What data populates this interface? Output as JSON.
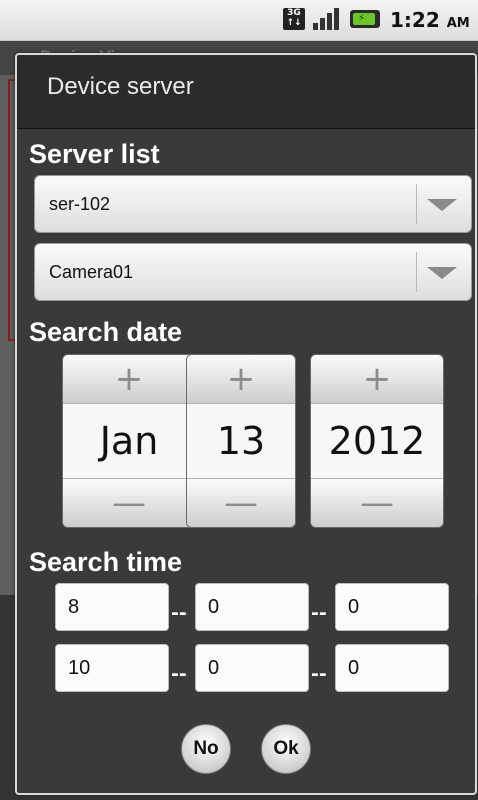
{
  "status_bar": {
    "network_type": "3G",
    "time": "1:22",
    "ampm": "AM",
    "icons": [
      "3g-icon",
      "signal-icon",
      "battery-charging-icon"
    ]
  },
  "background_app": {
    "title": "Device Viewer"
  },
  "dialog": {
    "title": "Device server",
    "server_list_label": "Server list",
    "server_select": "ser-102",
    "camera_select": "Camera01",
    "search_date_label": "Search date",
    "date": {
      "month": "Jan",
      "day": "13",
      "year": "2012",
      "increment_symbol": "+",
      "decrement_symbol": "—"
    },
    "search_time_label": "Search time",
    "time_from": {
      "hour": "8",
      "minute": "0",
      "second": "0"
    },
    "time_to": {
      "hour": "10",
      "minute": "0",
      "second": "0"
    },
    "time_separator": "--",
    "no_label": "No",
    "ok_label": "Ok"
  }
}
